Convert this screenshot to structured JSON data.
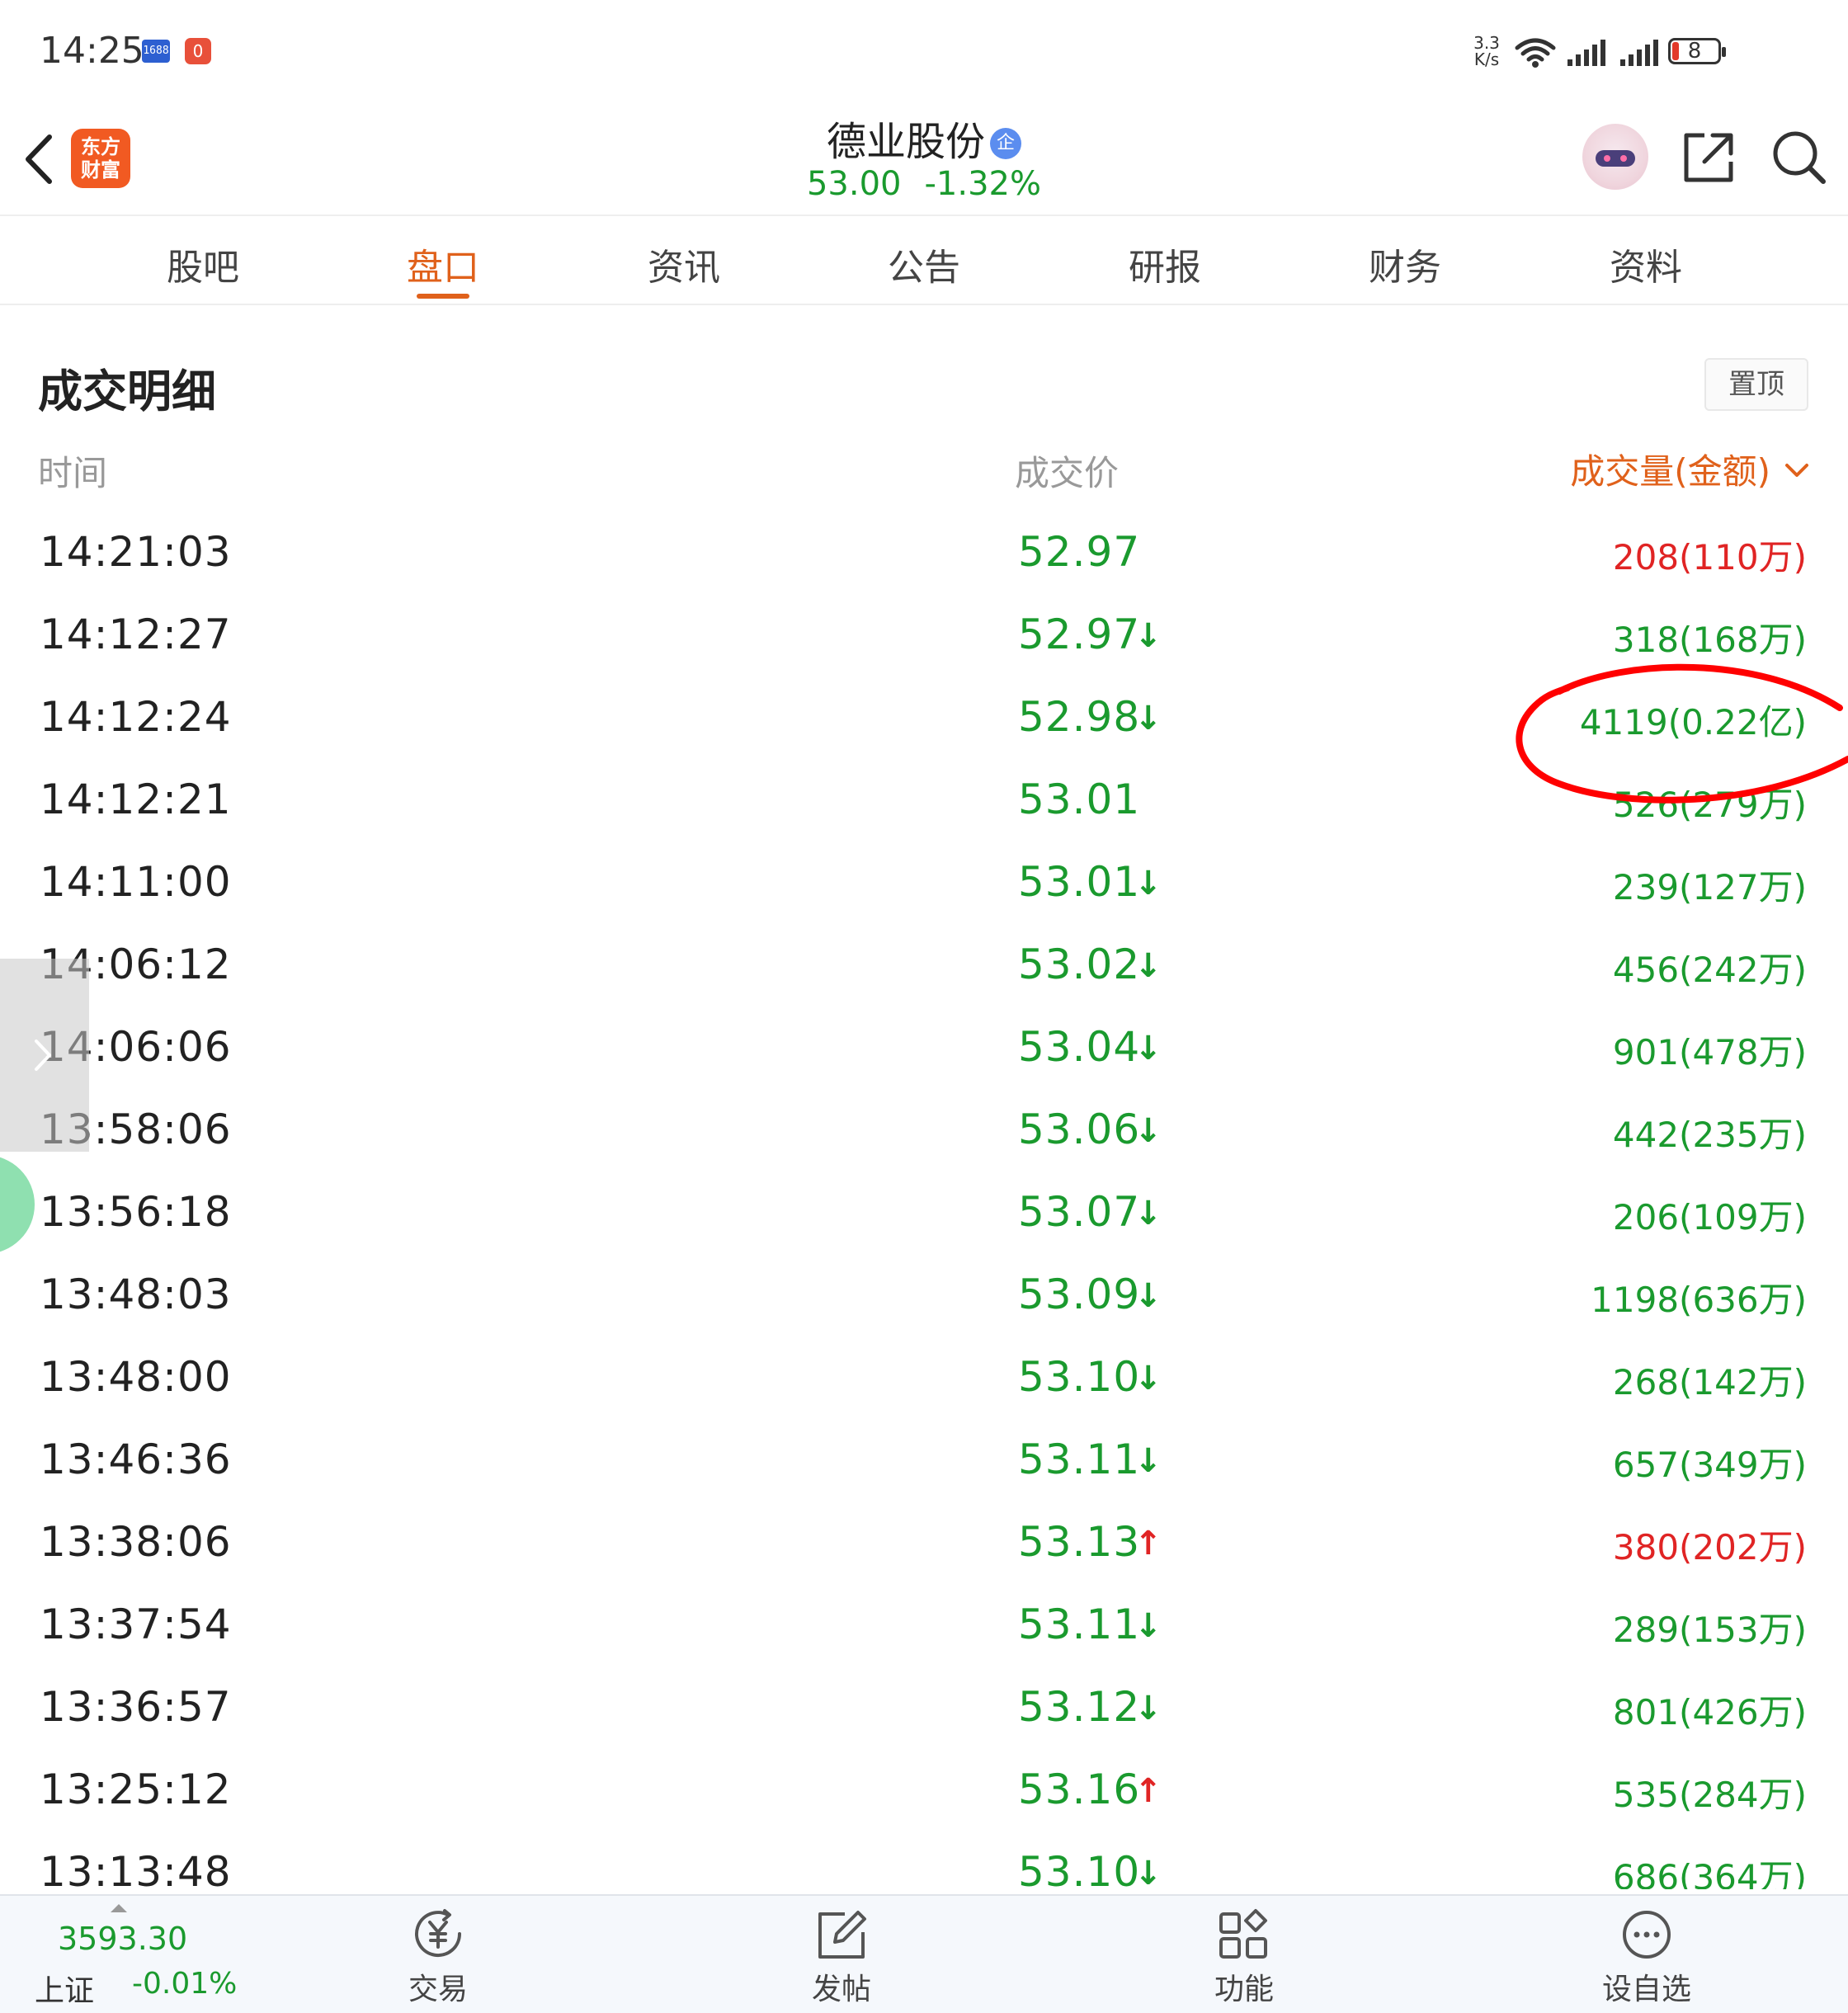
{
  "status_bar": {
    "time": "14:25",
    "badge_1688": "1688",
    "badge_red": "0",
    "net_speed_value": "3.3",
    "net_speed_unit": "K/s",
    "battery": "8"
  },
  "header": {
    "logo_line1": "东方",
    "logo_line2": "财富",
    "stock_name": "德业股份",
    "enterprise_badge": "企",
    "price": "53.00",
    "change_pct": "-1.32%"
  },
  "tabs": [
    {
      "label": "股吧"
    },
    {
      "label": "盘口",
      "active": true
    },
    {
      "label": "资讯"
    },
    {
      "label": "公告"
    },
    {
      "label": "研报"
    },
    {
      "label": "财务"
    },
    {
      "label": "资料"
    }
  ],
  "section": {
    "title": "成交明细",
    "pin_label": "置顶",
    "col_time": "时间",
    "col_price": "成交价",
    "col_volume": "成交量(金额)"
  },
  "trades": [
    {
      "time": "14:21:03",
      "price": "52.97",
      "arrow": "",
      "volume": "208(110万)",
      "vol_color": "red"
    },
    {
      "time": "14:12:27",
      "price": "52.97",
      "arrow": "down",
      "volume": "318(168万)",
      "vol_color": "green"
    },
    {
      "time": "14:12:24",
      "price": "52.98",
      "arrow": "down",
      "volume": "4119(0.22亿)",
      "vol_color": "green"
    },
    {
      "time": "14:12:21",
      "price": "53.01",
      "arrow": "",
      "volume": "526(279万)",
      "vol_color": "green"
    },
    {
      "time": "14:11:00",
      "price": "53.01",
      "arrow": "down",
      "volume": "239(127万)",
      "vol_color": "green"
    },
    {
      "time": "14:06:12",
      "price": "53.02",
      "arrow": "down",
      "volume": "456(242万)",
      "vol_color": "green"
    },
    {
      "time": "14:06:06",
      "price": "53.04",
      "arrow": "down",
      "volume": "901(478万)",
      "vol_color": "green"
    },
    {
      "time": "13:58:06",
      "price": "53.06",
      "arrow": "down",
      "volume": "442(235万)",
      "vol_color": "green"
    },
    {
      "time": "13:56:18",
      "price": "53.07",
      "arrow": "down",
      "volume": "206(109万)",
      "vol_color": "green"
    },
    {
      "time": "13:48:03",
      "price": "53.09",
      "arrow": "down",
      "volume": "1198(636万)",
      "vol_color": "green"
    },
    {
      "time": "13:48:00",
      "price": "53.10",
      "arrow": "down",
      "volume": "268(142万)",
      "vol_color": "green"
    },
    {
      "time": "13:46:36",
      "price": "53.11",
      "arrow": "down",
      "volume": "657(349万)",
      "vol_color": "green"
    },
    {
      "time": "13:38:06",
      "price": "53.13",
      "arrow": "up",
      "volume": "380(202万)",
      "vol_color": "red"
    },
    {
      "time": "13:37:54",
      "price": "53.11",
      "arrow": "down",
      "volume": "289(153万)",
      "vol_color": "green"
    },
    {
      "time": "13:36:57",
      "price": "53.12",
      "arrow": "down",
      "volume": "801(426万)",
      "vol_color": "green"
    },
    {
      "time": "13:25:12",
      "price": "53.16",
      "arrow": "up",
      "volume": "535(284万)",
      "vol_color": "green"
    },
    {
      "time": "13:13:48",
      "price": "53.10",
      "arrow": "down",
      "volume": "686(364万)",
      "vol_color": "green"
    }
  ],
  "arrows": {
    "down": "↓",
    "up": "↑"
  },
  "bottom_bar": {
    "index_value": "3593.30",
    "index_name": "上证",
    "index_change": "-0.01%",
    "nav": [
      {
        "label": "交易",
        "icon": "trade-yen-icon"
      },
      {
        "label": "发帖",
        "icon": "compose-icon"
      },
      {
        "label": "功能",
        "icon": "grid-icon"
      },
      {
        "label": "设自选",
        "icon": "more-circle-icon"
      }
    ]
  },
  "colors": {
    "accent": "#e0611b",
    "down_green": "#1a9a2e",
    "up_red": "#e02424",
    "annotation_red": "#ff0000"
  }
}
